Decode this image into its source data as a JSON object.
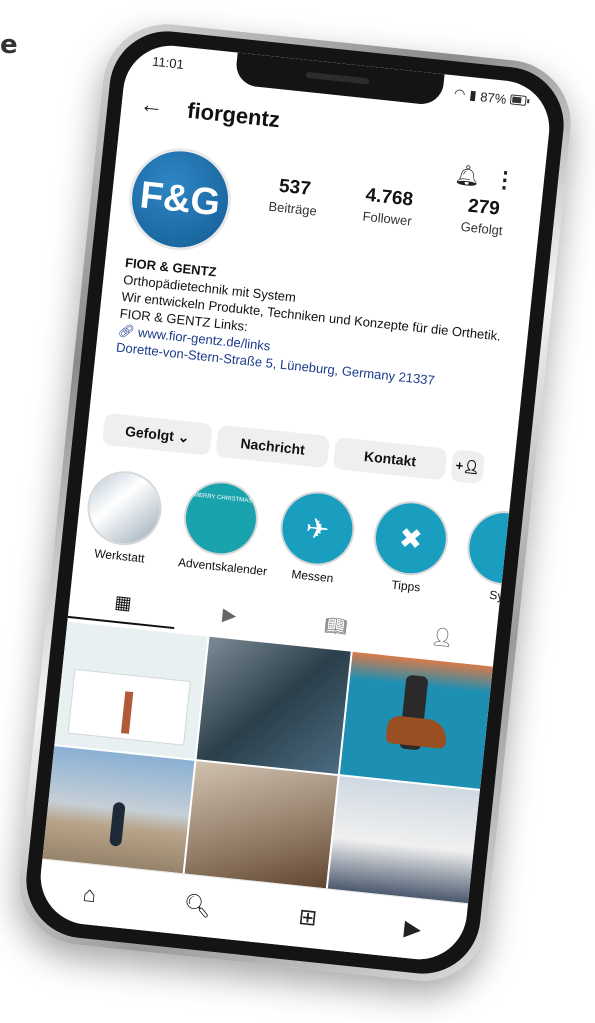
{
  "edge_text": "e",
  "status": {
    "time": "11:01",
    "battery": "87%"
  },
  "header": {
    "username": "fiorgentz"
  },
  "profile": {
    "logo": "F&G",
    "stats": [
      {
        "value": "537",
        "label": "Beiträge"
      },
      {
        "value": "4.768",
        "label": "Follower"
      },
      {
        "value": "279",
        "label": "Gefolgt"
      }
    ],
    "bio": {
      "name": "FIOR & GENTZ",
      "line1": "Orthopädietechnik mit System",
      "line2": "Wir entwickeln Produkte, Techniken und Konzepte für die Orthetik.",
      "line3": "FIOR & GENTZ Links:",
      "link": "www.fior-gentz.de/links",
      "address": "Dorette-von-Stern-Straße 5, Lüneburg, Germany 21337"
    }
  },
  "buttons": {
    "following": "Gefolgt",
    "message": "Nachricht",
    "contact": "Kontakt"
  },
  "highlights": [
    {
      "label": "Werkstatt"
    },
    {
      "label": "Adventskalender",
      "inner_text": "MERRY CHRISTMAS"
    },
    {
      "label": "Messen"
    },
    {
      "label": "Tipps"
    },
    {
      "label": "Sys"
    }
  ],
  "icons": {
    "back": "arrow-left-icon",
    "bell": "bell-icon",
    "more": "more-vertical-icon",
    "grid": "grid-icon",
    "reels": "reels-icon",
    "guides": "guides-icon",
    "tagged": "tagged-icon",
    "home": "home-icon",
    "search": "search-icon",
    "add": "add-icon",
    "reels_nav": "reels-icon"
  },
  "colors": {
    "brand_blue": "#135c94",
    "highlight_teal": "#1a9ec0",
    "link": "#1a3a8a"
  }
}
